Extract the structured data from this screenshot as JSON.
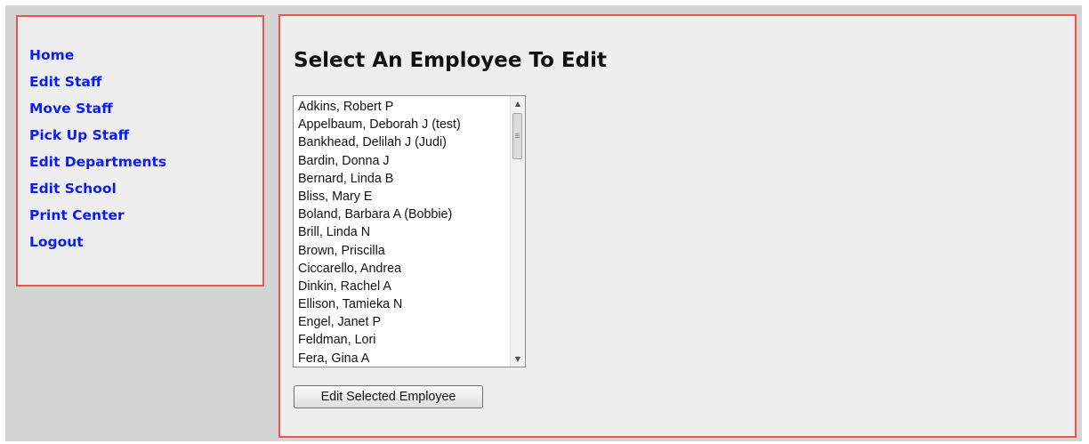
{
  "sidebar": {
    "items": [
      {
        "label": "Home"
      },
      {
        "label": "Edit Staff"
      },
      {
        "label": "Move Staff"
      },
      {
        "label": "Pick Up Staff"
      },
      {
        "label": "Edit Departments"
      },
      {
        "label": "Edit School"
      },
      {
        "label": "Print Center"
      },
      {
        "label": "Logout"
      }
    ]
  },
  "main": {
    "title": "Select An Employee To Edit",
    "employees": [
      "Adkins, Robert P",
      "Appelbaum, Deborah J (test)",
      "Bankhead, Delilah J (Judi)",
      "Bardin, Donna J",
      "Bernard, Linda B",
      "Bliss, Mary E",
      "Boland, Barbara A (Bobbie)",
      "Brill, Linda N",
      "Brown, Priscilla",
      "Ciccarello, Andrea",
      "Dinkin, Rachel A",
      "Ellison, Tamieka N",
      "Engel, Janet P",
      "Feldman, Lori",
      "Fera, Gina A"
    ],
    "button_label": "Edit Selected Employee"
  },
  "icons": {
    "scroll_up": "scroll-up-arrow-icon",
    "scroll_down": "scroll-down-arrow-icon"
  },
  "colors": {
    "link": "#0a1cf0",
    "panel_border": "#ef5350",
    "panel_background": "#eeeeee",
    "page_background": "#d4d4d4"
  }
}
